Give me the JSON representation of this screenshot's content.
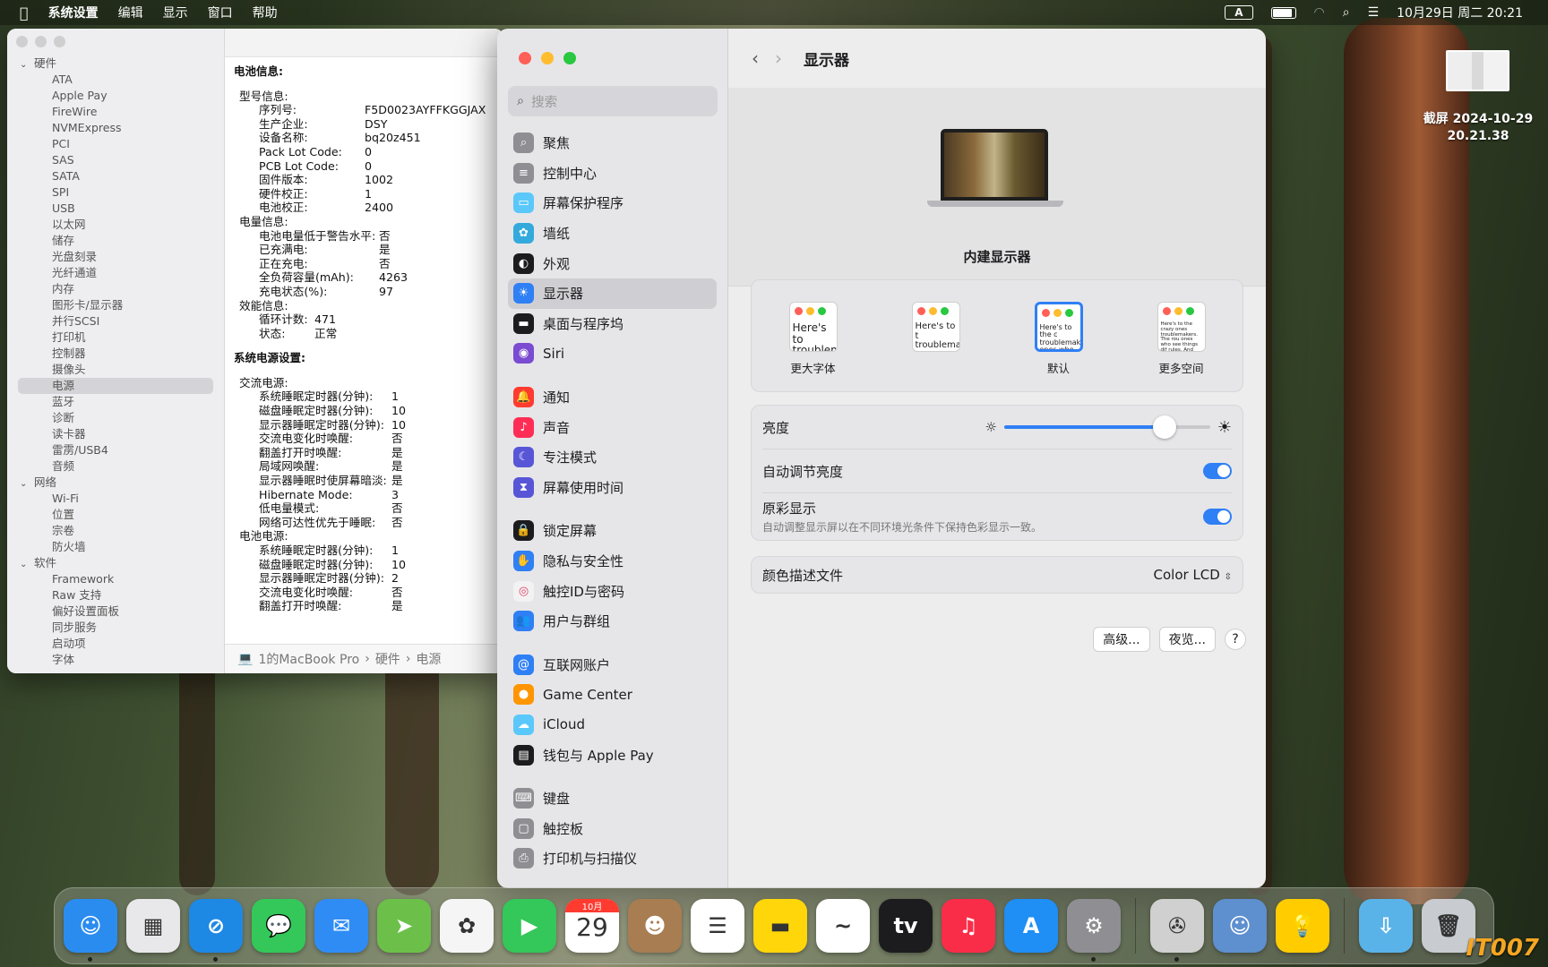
{
  "menubar": {
    "app": "系统设置",
    "items": [
      "编辑",
      "显示",
      "窗口",
      "帮助"
    ],
    "input": "A",
    "datetime": "10月29日 周二  20:21"
  },
  "sysinfo": {
    "tree": [
      {
        "t": "g",
        "label": "硬件"
      },
      {
        "t": "i",
        "label": "ATA"
      },
      {
        "t": "i",
        "label": "Apple Pay"
      },
      {
        "t": "i",
        "label": "FireWire"
      },
      {
        "t": "i",
        "label": "NVMExpress"
      },
      {
        "t": "i",
        "label": "PCI"
      },
      {
        "t": "i",
        "label": "SAS"
      },
      {
        "t": "i",
        "label": "SATA"
      },
      {
        "t": "i",
        "label": "SPI"
      },
      {
        "t": "i",
        "label": "USB"
      },
      {
        "t": "i",
        "label": "以太网"
      },
      {
        "t": "i",
        "label": "储存"
      },
      {
        "t": "i",
        "label": "光盘刻录"
      },
      {
        "t": "i",
        "label": "光纤通道"
      },
      {
        "t": "i",
        "label": "内存"
      },
      {
        "t": "i",
        "label": "图形卡/显示器"
      },
      {
        "t": "i",
        "label": "并行SCSI"
      },
      {
        "t": "i",
        "label": "打印机"
      },
      {
        "t": "i",
        "label": "控制器"
      },
      {
        "t": "i",
        "label": "摄像头"
      },
      {
        "t": "s",
        "label": "电源"
      },
      {
        "t": "i",
        "label": "蓝牙"
      },
      {
        "t": "i",
        "label": "诊断"
      },
      {
        "t": "i",
        "label": "读卡器"
      },
      {
        "t": "i",
        "label": "雷雳/USB4"
      },
      {
        "t": "i",
        "label": "音频"
      },
      {
        "t": "g",
        "label": "网络"
      },
      {
        "t": "i",
        "label": "Wi-Fi"
      },
      {
        "t": "i",
        "label": "位置"
      },
      {
        "t": "i",
        "label": "宗卷"
      },
      {
        "t": "i",
        "label": "防火墙"
      },
      {
        "t": "g",
        "label": "软件"
      },
      {
        "t": "i",
        "label": "Framework"
      },
      {
        "t": "i",
        "label": "Raw 支持"
      },
      {
        "t": "i",
        "label": "偏好设置面板"
      },
      {
        "t": "i",
        "label": "同步服务"
      },
      {
        "t": "i",
        "label": "启动项"
      },
      {
        "t": "i",
        "label": "字体"
      }
    ],
    "lines": [
      {
        "h": 1,
        "k": "电池信息:"
      },
      {
        "k": ""
      },
      {
        "i": 1,
        "k": "型号信息:"
      },
      {
        "i": 2,
        "k": "序列号:",
        "v": "F5D0023AYFFKGGJAX"
      },
      {
        "i": 2,
        "k": "生产企业:",
        "v": "DSY"
      },
      {
        "i": 2,
        "k": "设备名称:",
        "v": "bq20z451"
      },
      {
        "i": 2,
        "k": "Pack Lot Code:",
        "v": "0"
      },
      {
        "i": 2,
        "k": "PCB Lot Code:",
        "v": "0"
      },
      {
        "i": 2,
        "k": "固件版本:",
        "v": "1002"
      },
      {
        "i": 2,
        "k": "硬件校正:",
        "v": "1"
      },
      {
        "i": 2,
        "k": "电池校正:",
        "v": "2400"
      },
      {
        "i": 1,
        "k": "电量信息:"
      },
      {
        "i": 2,
        "k": "电池电量低于警告水平:",
        "v": "否",
        "w": 1
      },
      {
        "i": 2,
        "k": "已充满电:",
        "v": "是",
        "w": 1
      },
      {
        "i": 2,
        "k": "正在充电:",
        "v": "否",
        "w": 1
      },
      {
        "i": 2,
        "k": "全负荷容量(mAh):",
        "v": "4263",
        "w": 1
      },
      {
        "i": 2,
        "k": "充电状态(%):",
        "v": "97",
        "w": 1
      },
      {
        "i": 1,
        "k": "效能信息:"
      },
      {
        "i": 2,
        "k": "循环计数:",
        "v": "471",
        "w": 3
      },
      {
        "i": 2,
        "k": "状态:",
        "v": "正常",
        "w": 3
      },
      {
        "k": ""
      },
      {
        "h": 1,
        "k": "系统电源设置:"
      },
      {
        "k": ""
      },
      {
        "i": 1,
        "k": "交流电源:"
      },
      {
        "i": 2,
        "k": "系统睡眠定时器(分钟):",
        "v": "1",
        "w": 2
      },
      {
        "i": 2,
        "k": "磁盘睡眠定时器(分钟):",
        "v": "10",
        "w": 2
      },
      {
        "i": 2,
        "k": "显示器睡眠定时器(分钟):",
        "v": "10",
        "w": 2
      },
      {
        "i": 2,
        "k": "交流电变化时唤醒:",
        "v": "否",
        "w": 2
      },
      {
        "i": 2,
        "k": "翻盖打开时唤醒:",
        "v": "是",
        "w": 2
      },
      {
        "i": 2,
        "k": "局域网唤醒:",
        "v": "是",
        "w": 2
      },
      {
        "i": 2,
        "k": "显示器睡眠时使屏幕暗淡:",
        "v": "是",
        "w": 2
      },
      {
        "i": 2,
        "k": "Hibernate Mode:",
        "v": "3",
        "w": 2
      },
      {
        "i": 2,
        "k": "低电量模式:",
        "v": "否",
        "w": 2
      },
      {
        "i": 2,
        "k": "网络可达性优先于睡眠:",
        "v": "否",
        "w": 2
      },
      {
        "i": 1,
        "k": "电池电源:"
      },
      {
        "i": 2,
        "k": "系统睡眠定时器(分钟):",
        "v": "1",
        "w": 2
      },
      {
        "i": 2,
        "k": "磁盘睡眠定时器(分钟):",
        "v": "10",
        "w": 2
      },
      {
        "i": 2,
        "k": "显示器睡眠定时器(分钟):",
        "v": "2",
        "w": 2
      },
      {
        "i": 2,
        "k": "交流电变化时唤醒:",
        "v": "否",
        "w": 2
      },
      {
        "i": 2,
        "k": "翻盖打开时唤醒:",
        "v": "是",
        "w": 2
      }
    ],
    "footer": [
      "1的MacBook Pro",
      "硬件",
      "电源"
    ]
  },
  "settings": {
    "search_placeholder": "搜索",
    "nav": [
      {
        "label": "聚焦",
        "icon": "spotlight-icon",
        "color": "#8e8e93",
        "g": "⌕"
      },
      {
        "label": "控制中心",
        "icon": "control-center-icon",
        "color": "#8e8e93",
        "g": "≡"
      },
      {
        "label": "屏幕保护程序",
        "icon": "screensaver-icon",
        "color": "#5ac8fa",
        "g": "▭"
      },
      {
        "label": "墙纸",
        "icon": "wallpaper-icon",
        "color": "#34aadc",
        "g": "✿"
      },
      {
        "label": "外观",
        "icon": "appearance-icon",
        "color": "#1c1c1e",
        "g": "◐"
      },
      {
        "label": "显示器",
        "icon": "display-icon",
        "color": "#2f7ff5",
        "g": "☀",
        "sel": 1
      },
      {
        "label": "桌面与程序坞",
        "icon": "desktop-dock-icon",
        "color": "#1c1c1e",
        "g": "▬"
      },
      {
        "label": "Siri",
        "icon": "siri-icon",
        "color": "#7b4bd1",
        "g": "◉",
        "gap": 1
      },
      {
        "label": "通知",
        "icon": "notifications-icon",
        "color": "#ff3b30",
        "g": "🔔"
      },
      {
        "label": "声音",
        "icon": "sound-icon",
        "color": "#ff2d55",
        "g": "♪"
      },
      {
        "label": "专注模式",
        "icon": "focus-icon",
        "color": "#5856d6",
        "g": "☾"
      },
      {
        "label": "屏幕使用时间",
        "icon": "screen-time-icon",
        "color": "#5856d6",
        "g": "⧗",
        "gap": 1
      },
      {
        "label": "锁定屏幕",
        "icon": "lock-screen-icon",
        "color": "#1c1c1e",
        "g": "🔒"
      },
      {
        "label": "隐私与安全性",
        "icon": "privacy-icon",
        "color": "#2f7ff5",
        "g": "✋"
      },
      {
        "label": "触控ID与密码",
        "icon": "touch-id-icon",
        "color": "#f2f2f2",
        "g": "◎"
      },
      {
        "label": "用户与群组",
        "icon": "users-icon",
        "color": "#2f7ff5",
        "g": "👥",
        "gap": 1
      },
      {
        "label": "互联网账户",
        "icon": "internet-accounts-icon",
        "color": "#2f7ff5",
        "g": "@"
      },
      {
        "label": "Game Center",
        "icon": "game-center-icon",
        "color": "#ff9500",
        "g": "●"
      },
      {
        "label": "iCloud",
        "icon": "icloud-icon",
        "color": "#5ac8fa",
        "g": "☁"
      },
      {
        "label": "钱包与 Apple Pay",
        "icon": "wallet-icon",
        "color": "#1c1c1e",
        "g": "▤",
        "gap": 1
      },
      {
        "label": "键盘",
        "icon": "keyboard-icon",
        "color": "#8e8e93",
        "g": "⌨"
      },
      {
        "label": "触控板",
        "icon": "trackpad-icon",
        "color": "#8e8e93",
        "g": "▢"
      },
      {
        "label": "打印机与扫描仪",
        "icon": "printer-icon",
        "color": "#8e8e93",
        "g": "⎙"
      }
    ],
    "title": "显示器",
    "display_name": "内建显示器",
    "resolutions": [
      {
        "label": "更大字体",
        "sample": "Here's to troublem"
      },
      {
        "label": "",
        "sample": "Here's to t troublema ones who"
      },
      {
        "label": "默认",
        "sample": "Here's to the c troublemakers. ones who see t rules. And they",
        "sel": 1
      },
      {
        "label": "更多空间",
        "sample": "Here's to the crazy ones troublemakers. The rou ones who see things dif rules. And they have no can quote them, disagre them. About the only th Because they change th"
      }
    ],
    "brightness_label": "亮度",
    "brightness": 0.78,
    "auto_brightness_label": "自动调节亮度",
    "true_tone_label": "原彩显示",
    "true_tone_desc": "自动调整显示屏以在不同环境光条件下保持色彩显示一致。",
    "profile_label": "颜色描述文件",
    "profile_value": "Color LCD",
    "btn_advanced": "高级...",
    "btn_night": "夜览...",
    "btn_help": "?"
  },
  "desktop": {
    "screenshot_label": "截屏 2024-10-29\n20.21.38"
  },
  "dock": [
    {
      "n": "finder",
      "c": "#2b8cf0",
      "g": "☺",
      "dot": 1
    },
    {
      "n": "launchpad",
      "c": "#e8e8ea",
      "g": "▦"
    },
    {
      "n": "safari",
      "c": "#1e88e5",
      "g": "⊘",
      "dot": 1
    },
    {
      "n": "messages",
      "c": "#34c759",
      "g": "💬"
    },
    {
      "n": "mail",
      "c": "#2f8cf5",
      "g": "✉"
    },
    {
      "n": "maps",
      "c": "#6cc04a",
      "g": "➤"
    },
    {
      "n": "photos",
      "c": "#f5f5f5",
      "g": "✿"
    },
    {
      "n": "facetime",
      "c": "#34c759",
      "g": "▶"
    },
    {
      "n": "calendar",
      "c": "#ffffff",
      "g": "29",
      "month": "10月"
    },
    {
      "n": "contacts",
      "c": "#a87d52",
      "g": "☻"
    },
    {
      "n": "reminders",
      "c": "#ffffff",
      "g": "☰"
    },
    {
      "n": "notes",
      "c": "#ffd60a",
      "g": "▬"
    },
    {
      "n": "freeform",
      "c": "#ffffff",
      "g": "~"
    },
    {
      "n": "tv",
      "c": "#1c1c1e",
      "g": "tv"
    },
    {
      "n": "music",
      "c": "#fa2d48",
      "g": "♫"
    },
    {
      "n": "app-store",
      "c": "#1f8ef5",
      "g": "A"
    },
    {
      "n": "system-settings",
      "c": "#8e8e93",
      "g": "⚙",
      "dot": 1
    },
    {
      "sep": 1
    },
    {
      "n": "system-information",
      "c": "#d0d0d0",
      "g": "✇",
      "dot": 1
    },
    {
      "n": "migration-assistant",
      "c": "#5e8fcf",
      "g": "☺"
    },
    {
      "n": "tips",
      "c": "#ffcc00",
      "g": "💡"
    },
    {
      "sep": 1
    },
    {
      "n": "downloads",
      "c": "#5ab3e8",
      "g": "⇩"
    },
    {
      "n": "trash",
      "c": "#c8ccd0",
      "g": "🗑"
    }
  ],
  "watermark": "IT007"
}
